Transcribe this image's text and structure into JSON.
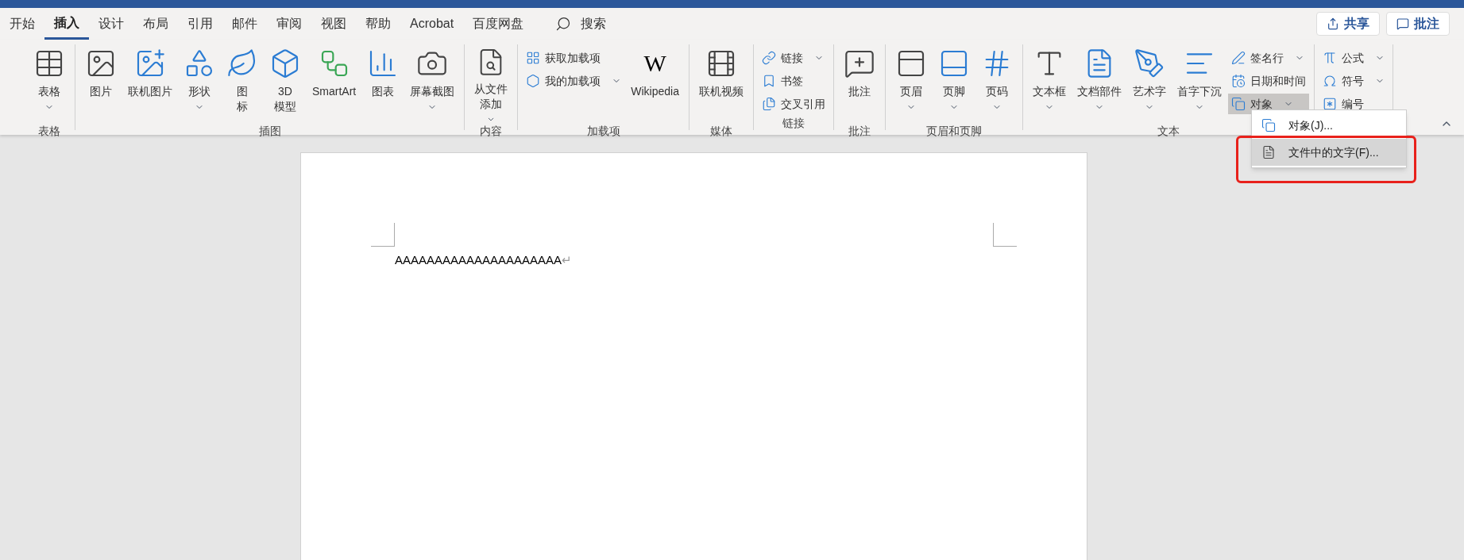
{
  "tabs": [
    {
      "label": "开始",
      "selected": false
    },
    {
      "label": "插入",
      "selected": true
    },
    {
      "label": "设计",
      "selected": false
    },
    {
      "label": "布局",
      "selected": false
    },
    {
      "label": "引用",
      "selected": false
    },
    {
      "label": "邮件",
      "selected": false
    },
    {
      "label": "审阅",
      "selected": false
    },
    {
      "label": "视图",
      "selected": false
    },
    {
      "label": "帮助",
      "selected": false
    },
    {
      "label": "Acrobat",
      "selected": false
    },
    {
      "label": "百度网盘",
      "selected": false
    }
  ],
  "search": {
    "label": "搜索"
  },
  "actions": [
    {
      "label": "共享"
    },
    {
      "label": "批注"
    }
  ],
  "ribbon": {
    "groups": [
      {
        "label": "表格",
        "items": [
          {
            "kind": "large",
            "lines": [
              "表格"
            ],
            "dropdown": true
          }
        ]
      },
      {
        "label": "插图",
        "items": [
          {
            "kind": "large",
            "lines": [
              "图片"
            ],
            "dropdown": false
          },
          {
            "kind": "large",
            "lines": [
              "联机图片"
            ],
            "dropdown": false
          },
          {
            "kind": "large",
            "lines": [
              "形状"
            ],
            "dropdown": true
          },
          {
            "kind": "large",
            "lines": [
              "图",
              "标"
            ],
            "dropdown": false
          },
          {
            "kind": "large",
            "lines": [
              "3D",
              "模型"
            ],
            "dropdown": false
          },
          {
            "kind": "large",
            "lines": [
              "SmartArt"
            ],
            "dropdown": false
          },
          {
            "kind": "large",
            "lines": [
              "图表"
            ],
            "dropdown": false
          },
          {
            "kind": "large",
            "lines": [
              "屏幕截图"
            ],
            "dropdown": true
          }
        ]
      },
      {
        "label": "内容",
        "items": [
          {
            "kind": "large",
            "lines": [
              "从文件",
              "添加"
            ],
            "dropdown": true
          }
        ]
      },
      {
        "label": "加载项",
        "items": [
          {
            "kind": "stack",
            "rows": [
              {
                "label": "获取加载项",
                "dropdown": false,
                "pressed": false
              },
              {
                "label": "我的加载项",
                "dropdown": true,
                "pressed": false
              }
            ]
          },
          {
            "kind": "large",
            "logo": "W",
            "lines": [
              "Wikipedia"
            ],
            "dropdown": false
          }
        ]
      },
      {
        "label": "媒体",
        "items": [
          {
            "kind": "large",
            "lines": [
              "联机视频"
            ],
            "dropdown": false
          }
        ]
      },
      {
        "label": "链接",
        "items": [
          {
            "kind": "stack",
            "rows": [
              {
                "label": "链接",
                "dropdown": true,
                "pressed": false
              },
              {
                "label": "书签",
                "dropdown": false,
                "pressed": false
              },
              {
                "label": "交叉引用",
                "dropdown": false,
                "pressed": false
              }
            ]
          }
        ]
      },
      {
        "label": "批注",
        "items": [
          {
            "kind": "large",
            "lines": [
              "批注"
            ],
            "dropdown": false
          }
        ]
      },
      {
        "label": "页眉和页脚",
        "items": [
          {
            "kind": "large",
            "lines": [
              "页眉"
            ],
            "dropdown": true
          },
          {
            "kind": "large",
            "lines": [
              "页脚"
            ],
            "dropdown": true
          },
          {
            "kind": "large",
            "lines": [
              "页码"
            ],
            "dropdown": true
          }
        ]
      },
      {
        "label": "文本",
        "items": [
          {
            "kind": "large",
            "lines": [
              "文本框"
            ],
            "dropdown": true
          },
          {
            "kind": "large",
            "lines": [
              "文档部件"
            ],
            "dropdown": true
          },
          {
            "kind": "large",
            "lines": [
              "艺术字"
            ],
            "dropdown": true
          },
          {
            "kind": "large",
            "lines": [
              "首字下沉"
            ],
            "dropdown": true
          },
          {
            "kind": "stack",
            "rows": [
              {
                "label": "签名行",
                "dropdown": true,
                "pressed": false
              },
              {
                "label": "日期和时间",
                "dropdown": false,
                "pressed": false
              },
              {
                "label": "对象",
                "dropdown": true,
                "pressed": true
              }
            ]
          }
        ]
      },
      {
        "items": [
          {
            "kind": "stack",
            "rows": [
              {
                "label": "公式",
                "dropdown": true,
                "pressed": false
              },
              {
                "label": "符号",
                "dropdown": true,
                "pressed": false
              },
              {
                "label": "编号",
                "dropdown": false,
                "pressed": false
              }
            ]
          }
        ]
      }
    ]
  },
  "menu": {
    "items": [
      {
        "label": "对象(J)...",
        "selected": false,
        "annotated": false
      },
      {
        "label": "文件中的文字(F)...",
        "selected": true,
        "annotated": true
      }
    ]
  },
  "document": {
    "paragraph": "AAAAAAAAAAAAAAAAAAAAA",
    "paragraph_mark": "↵"
  }
}
